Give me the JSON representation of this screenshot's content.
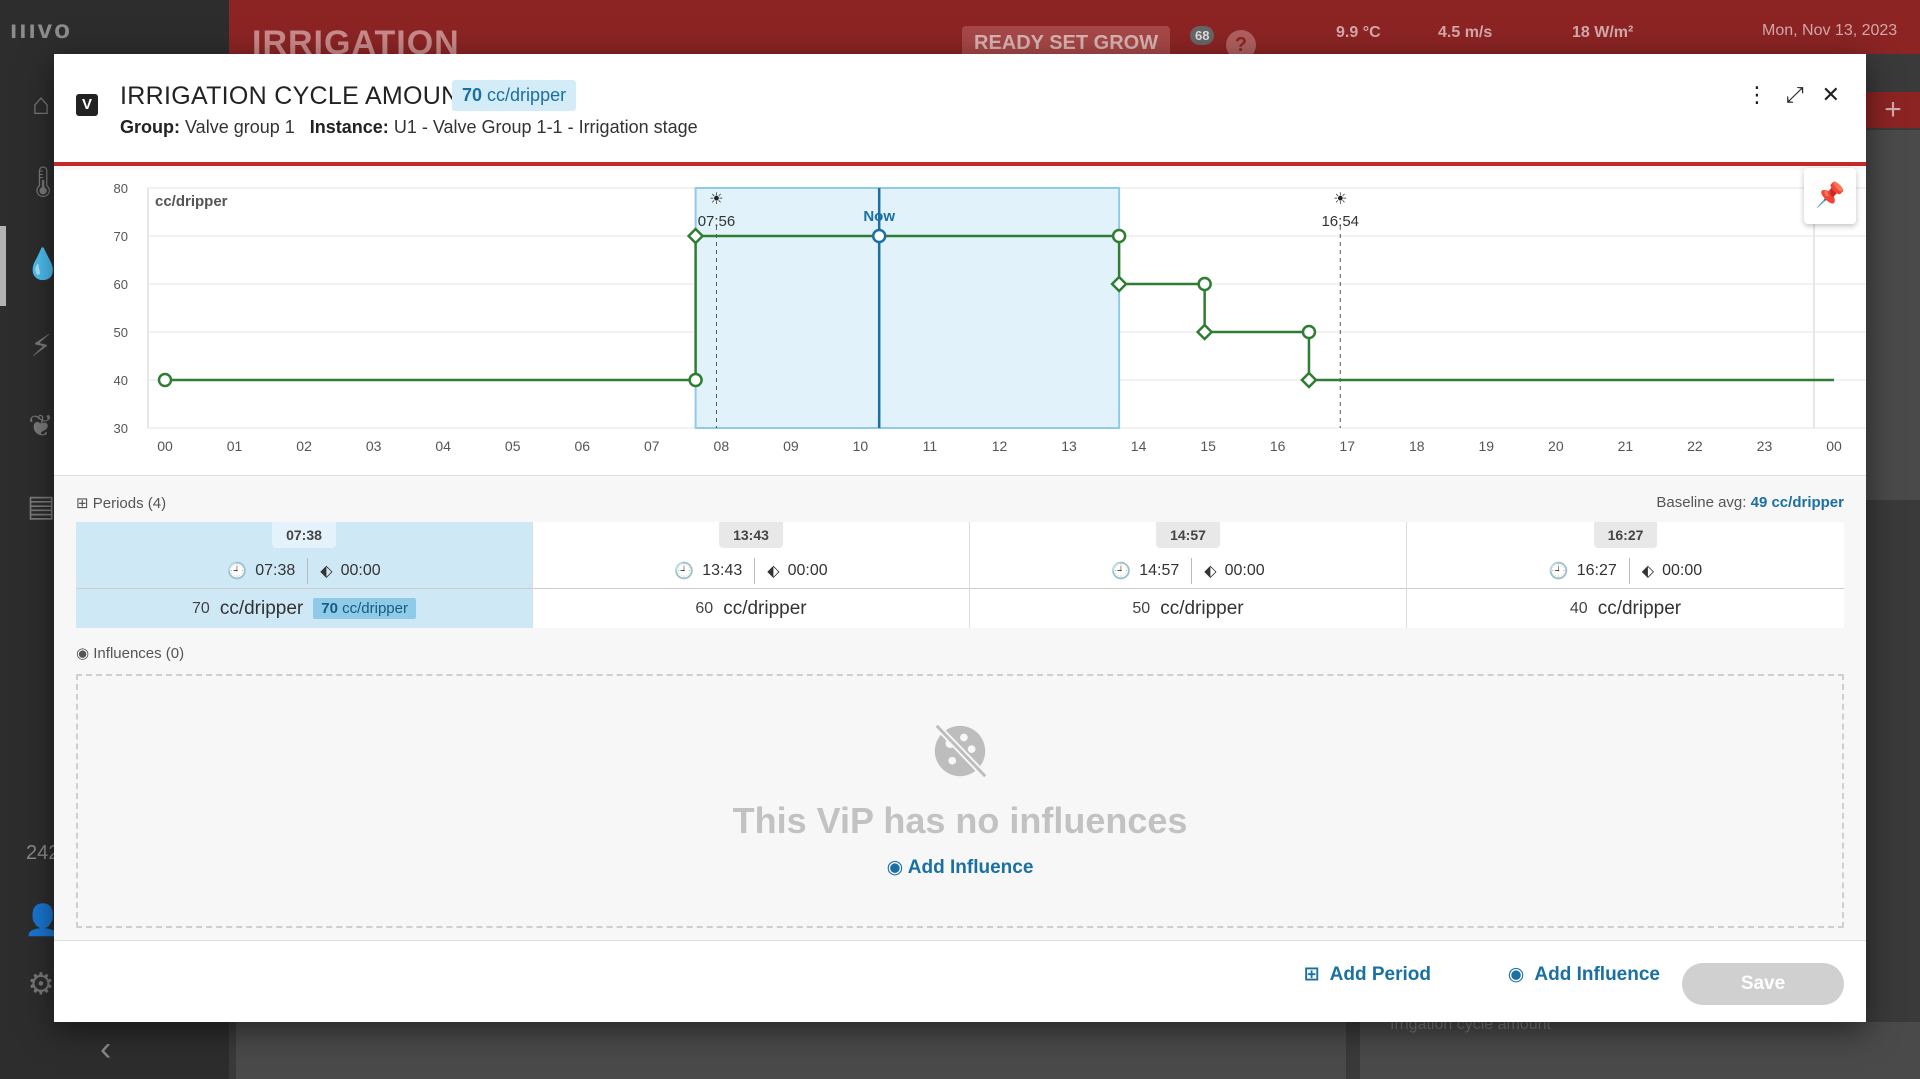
{
  "app": {
    "logo": "ıııvo",
    "title": "IRRIGATION",
    "ready_set_grow": "READY SET GROW",
    "notifications_count": "68",
    "help": "?",
    "temperature": "9.9 °C",
    "wind": "4.5 m/s",
    "radiation": "18 W/m²",
    "date": "Mon, Nov 13, 2023",
    "side_number": "242",
    "bottom_text": "Irrigation cycle amount"
  },
  "modal": {
    "badge": "V",
    "title": "IRRIGATION CYCLE AMOUNT",
    "title_value": "70",
    "title_unit": "cc/dripper",
    "group_label": "Group:",
    "group_value": "Valve group 1",
    "instance_label": "Instance:",
    "instance_value": "U1 - Valve Group 1-1 - Irrigation stage",
    "more_icon": "⋮",
    "expand_icon": "⤢",
    "close_icon": "✕"
  },
  "chart_data": {
    "type": "line",
    "ylabel": "cc/dripper",
    "ylim": [
      30,
      80
    ],
    "yticks": [
      "30",
      "40",
      "50",
      "60",
      "70",
      "80"
    ],
    "xticks": [
      "00",
      "01",
      "02",
      "03",
      "04",
      "05",
      "06",
      "07",
      "08",
      "09",
      "10",
      "11",
      "12",
      "13",
      "14",
      "15",
      "16",
      "17",
      "18",
      "19",
      "20",
      "21",
      "22",
      "23",
      "00"
    ],
    "xlim": [
      0,
      24
    ],
    "series": [
      {
        "points": [
          [
            0.0,
            40
          ],
          [
            7.63,
            40
          ],
          [
            7.63,
            70
          ],
          [
            13.72,
            70
          ],
          [
            13.72,
            60
          ],
          [
            14.95,
            60
          ],
          [
            14.95,
            50
          ],
          [
            16.45,
            50
          ],
          [
            16.45,
            40
          ],
          [
            24.0,
            40
          ]
        ]
      }
    ],
    "circle_markers": [
      [
        0.0,
        40
      ],
      [
        7.63,
        40
      ],
      [
        13.72,
        70
      ],
      [
        14.95,
        60
      ],
      [
        16.45,
        50
      ]
    ],
    "diamond_markers": [
      [
        7.63,
        70
      ],
      [
        13.72,
        60
      ],
      [
        14.95,
        50
      ],
      [
        16.45,
        40
      ]
    ],
    "highlight_range": [
      7.63,
      13.72
    ],
    "now": {
      "x": 10.27,
      "y": 70,
      "label": "Now"
    },
    "sunrise": {
      "x": 7.93,
      "label": "07:56"
    },
    "sunset": {
      "x": 16.9,
      "label": "16:54"
    }
  },
  "periods": {
    "label": "Periods (4)",
    "baseline_label": "Baseline avg:",
    "baseline_value": "49 cc/dripper",
    "items": [
      {
        "tab": "07:38",
        "start": "07:38",
        "ramp": "00:00",
        "value": "70",
        "unit": "cc/dripper",
        "pill_value": "70",
        "pill_unit": "cc/dripper"
      },
      {
        "tab": "13:43",
        "start": "13:43",
        "ramp": "00:00",
        "value": "60",
        "unit": "cc/dripper"
      },
      {
        "tab": "14:57",
        "start": "14:57",
        "ramp": "00:00",
        "value": "50",
        "unit": "cc/dripper"
      },
      {
        "tab": "16:27",
        "start": "16:27",
        "ramp": "00:00",
        "value": "40",
        "unit": "cc/dripper"
      }
    ]
  },
  "influences": {
    "label": "Influences (0)",
    "empty_text": "This ViP has no influences",
    "add_link": "Add Influence"
  },
  "footer": {
    "add_period": "Add Period",
    "add_influence": "Add Influence",
    "save": "Save"
  },
  "colors": {
    "accent": "#1a6fa3",
    "line": "#2e7d32",
    "header_red": "#c62828",
    "highlight": "#cfe8f5"
  }
}
